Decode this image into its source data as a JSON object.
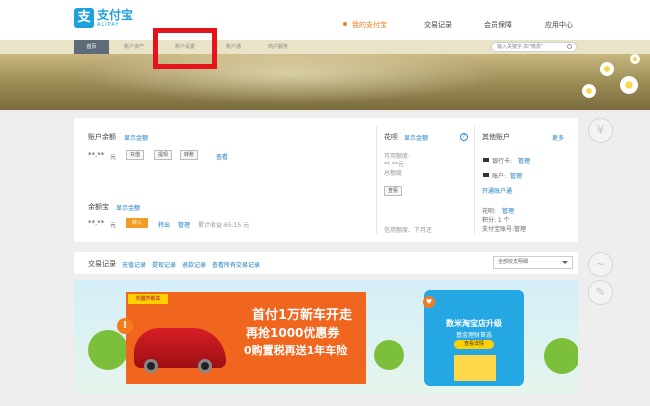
{
  "logo": {
    "icon": "支",
    "cn": "支付宝",
    "en": "ALIPAY"
  },
  "topnav": {
    "my": "我的支付宝",
    "trade": "交易记录",
    "member": "会员保障",
    "apps": "应用中心"
  },
  "subnav": {
    "home": "首页",
    "account_assets": "账户资产",
    "account_settings": "账户设置",
    "account_pass": "账户通",
    "merchant": "商户服务",
    "search_placeholder": "输入关键字,如\"缴费\""
  },
  "balance": {
    "label": "账户余额",
    "show": "显示金额",
    "value": "**.**",
    "unit": "元",
    "recharge": "充值",
    "withdraw": "提现",
    "transfer": "转账",
    "view": "查看"
  },
  "yuebao": {
    "label": "余额宝",
    "show": "显示金额",
    "value": "**.**",
    "unit": "元",
    "transfer_in": "转入",
    "transfer_out": "转出",
    "manage": "管理",
    "yesterday": "累计收益:65.15 元"
  },
  "huabei": {
    "label": "花呗",
    "show": "显示金额",
    "avail": "可用额度:",
    "value": "**.**元",
    "total": "总额度",
    "button": "查看",
    "bill": "信用额度、下月还"
  },
  "other": {
    "label": "其他账户",
    "more": "更多",
    "bank_card": "银行卡:",
    "bank_manage": "管理",
    "account": "账户:",
    "account_manage": "管理",
    "open": "开通账户通",
    "huabei": "花呗:",
    "huabei_manage": "管理",
    "points": "积分: 1 个",
    "cert": "支付宝账号:管理"
  },
  "transactions": {
    "label": "交易记录",
    "recharge": "充值记录",
    "withdraw": "提现记录",
    "refund": "退款记录",
    "all": "查看所有交易记录",
    "select": "全部收支明细"
  },
  "ad": {
    "tag": "天猫开新车",
    "line1": "首付1万新车开走",
    "line2": "再抢1000优惠券",
    "line3": "0购置税再送1年车险",
    "right_title": "数米淘宝店升级",
    "right_sub": "基金理财首选",
    "right_btn": "查看详情"
  },
  "icons": [
    "search-icon",
    "help-icon",
    "bank-card-icon",
    "warning-icon",
    "heart-icon"
  ]
}
